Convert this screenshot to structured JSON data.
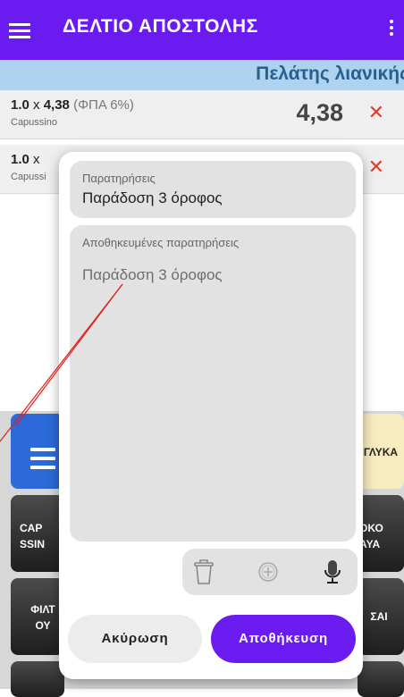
{
  "appbar": {
    "title": "ΔΕΛΤΙΟ ΑΠΟΣΤΟΛΗΣ"
  },
  "customer": {
    "label": "Πελάτης λιανικής"
  },
  "order_lines": [
    {
      "qty": "1.0",
      "times": "x",
      "price": "4,38",
      "vat": "(ΦΠΑ 6%)",
      "name": "Capussino",
      "total": "4,38"
    },
    {
      "qty": "1.0",
      "times": "x",
      "price": "",
      "vat": "",
      "name": "Capussi",
      "total": ""
    }
  ],
  "tiles": {
    "glyka": "ΓΛΥΚΑ",
    "capussino": "CAP\nSSIN",
    "choko": "ΟΚΟ\nΑΥΑ",
    "filtrou": "ΦΙΛΤ\nΟΥ",
    "sai": "ΣΑΙ"
  },
  "dialog": {
    "notes_label": "Παρατηρήσεις",
    "notes_value": "Παράδοση 3 όροφος",
    "saved_label": "Αποθηκευμένες παρατηρήσεις",
    "saved_items": [
      "Παράδοση 3 όροφος"
    ],
    "cancel": "Ακύρωση",
    "save": "Αποθήκευση"
  },
  "icons": {
    "delete": "trash-icon",
    "add": "add-circle-icon",
    "mic": "microphone-icon"
  },
  "colors": {
    "primary": "#6a1bf0",
    "customer_bar": "#add3f1",
    "delete_x": "#e23c2c"
  }
}
